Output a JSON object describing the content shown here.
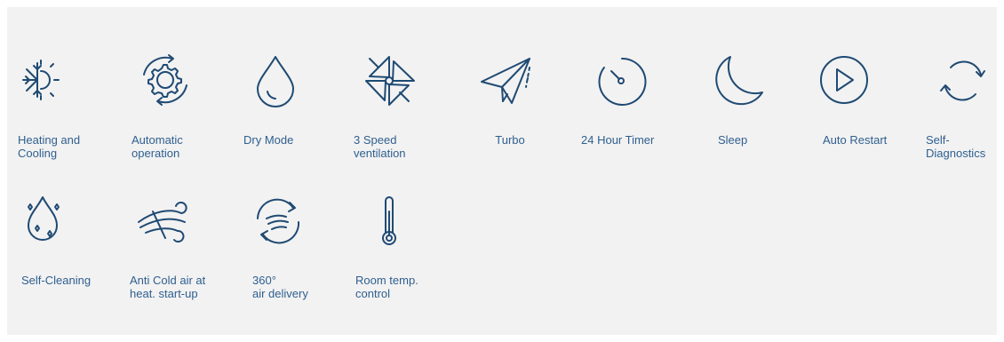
{
  "colors": {
    "icon_stroke": "#1f4a73",
    "label_text": "#2f5f8f",
    "panel_bg": "#f2f2f2"
  },
  "features": [
    {
      "icon": "heating-cooling-icon",
      "label": "Heating and\nCooling"
    },
    {
      "icon": "automatic-operation-icon",
      "label": "Automatic\noperation"
    },
    {
      "icon": "dry-mode-icon",
      "label": "Dry Mode"
    },
    {
      "icon": "three-speed-ventilation-icon",
      "label": "3 Speed\nventilation"
    },
    {
      "icon": "turbo-icon",
      "label": "Turbo"
    },
    {
      "icon": "timer-icon",
      "label": "24 Hour Timer"
    },
    {
      "icon": "sleep-icon",
      "label": "Sleep"
    },
    {
      "icon": "auto-restart-icon",
      "label": "Auto Restart"
    },
    {
      "icon": "self-diagnostics-icon",
      "label": "Self-\nDiagnostics"
    },
    {
      "icon": "self-cleaning-icon",
      "label": "Self-Cleaning"
    },
    {
      "icon": "anti-cold-air-icon",
      "label": "Anti Cold air at\nheat. start-up"
    },
    {
      "icon": "air-delivery-360-icon",
      "label": "360°\nair delivery"
    },
    {
      "icon": "thermometer-icon",
      "label": "Room temp.\ncontrol"
    }
  ]
}
